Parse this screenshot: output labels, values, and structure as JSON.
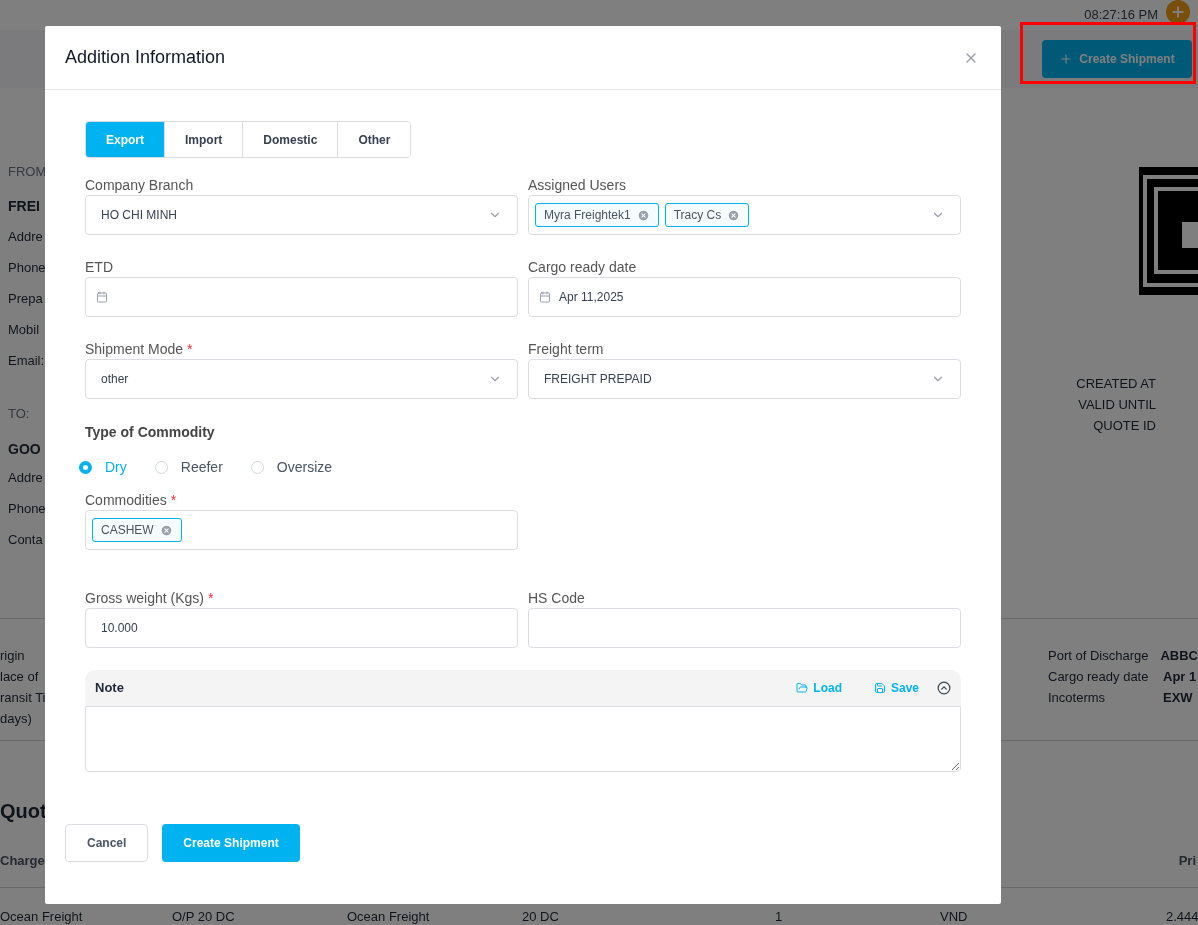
{
  "background": {
    "time": "08:27:16 PM",
    "create_button": "Create Shipment",
    "from_section": {
      "heading": "FROM",
      "name": "FREI",
      "fields": [
        "Addre",
        "Phone",
        "Prepa",
        "Mobil",
        "Email:"
      ]
    },
    "to_section": {
      "heading": "TO:",
      "name": "GOO",
      "fields": [
        "Addre",
        "Phone",
        "Conta"
      ]
    },
    "quote_meta": [
      "CREATED AT",
      "VALID UNTIL",
      "QUOTE ID"
    ],
    "route_left": [
      "rigin",
      "lace of",
      "ransit Ti",
      "days)"
    ],
    "route_right": [
      {
        "label": "Port of Discharge",
        "value": "ABBC"
      },
      {
        "label": "Cargo ready date",
        "value": "Apr 1"
      },
      {
        "label": "Incoterms",
        "value": "EXW"
      }
    ],
    "quotes_title": "Quot",
    "table_headers": [
      "Charge",
      "Pri"
    ],
    "row": [
      "Ocean Freight",
      "O/P 20 DC",
      "Ocean Freight",
      "20 DC",
      "1",
      "VND",
      "2.444"
    ]
  },
  "modal": {
    "title": "Addition Information",
    "required_mark": "*",
    "tabs": [
      {
        "label": "Export",
        "selected": true
      },
      {
        "label": "Import",
        "selected": false
      },
      {
        "label": "Domestic",
        "selected": false
      },
      {
        "label": "Other",
        "selected": false
      }
    ],
    "rows": [
      [
        {
          "label": "Company Branch",
          "required": false,
          "kind": "select",
          "value": "HO CHI MINH"
        },
        {
          "label": "Assigned Users",
          "required": false,
          "kind": "tags",
          "tags": [
            "Myra Freightek1",
            "Tracy Cs"
          ]
        }
      ],
      [
        {
          "label": "ETD",
          "required": false,
          "kind": "date"
        },
        {
          "label": "Cargo ready date",
          "required": false,
          "kind": "date",
          "value": "Apr 11,2025"
        }
      ],
      [
        {
          "label": "Shipment Mode",
          "required": true,
          "kind": "select",
          "value": "other"
        },
        {
          "label": "Freight term",
          "required": false,
          "kind": "select",
          "value": "FREIGHT PREPAID"
        }
      ]
    ],
    "commodity_type": {
      "title": "Type of Commodity",
      "options": [
        {
          "label": "Dry",
          "selected": true
        },
        {
          "label": "Reefer",
          "selected": false
        },
        {
          "label": "Oversize",
          "selected": false
        }
      ]
    },
    "commodities": {
      "label": "Commodities",
      "required": true,
      "tags": [
        "CASHEW"
      ]
    },
    "rows2": [
      [
        {
          "label": "Gross weight (Kgs)",
          "required": true,
          "kind": "text",
          "value": "10.000"
        },
        {
          "label": "HS Code",
          "required": false,
          "kind": "text"
        }
      ]
    ],
    "note": {
      "title": "Note",
      "actions": [
        {
          "kind": "load",
          "label": "Load"
        },
        {
          "kind": "save",
          "label": "Save"
        }
      ]
    },
    "buttons": [
      {
        "kind": "secondary",
        "label": "Cancel"
      },
      {
        "kind": "primary",
        "label": "Create Shipment"
      }
    ]
  }
}
